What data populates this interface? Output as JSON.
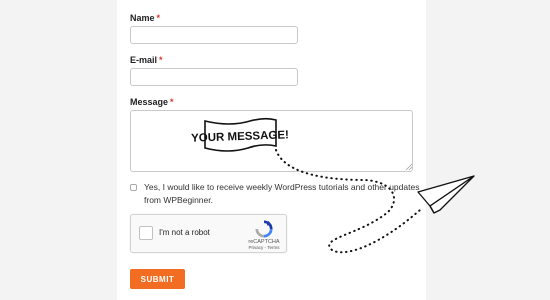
{
  "form": {
    "name_label": "Name",
    "email_label": "E-mail",
    "message_label": "Message",
    "required_mark": "*",
    "name_value": "",
    "email_value": "",
    "message_value": "",
    "consent_line1": "Yes, I would like to receive weekly WordPress tutorials and other updates",
    "consent_line2": "from WPBeginner.",
    "submit_label": "SUBMIT"
  },
  "captcha": {
    "label": "I'm not a robot",
    "brand": "reCAPTCHA",
    "links": "Privacy - Terms"
  },
  "annotation": {
    "sign_text": "YOUR MESSAGE!",
    "icon": "paper-plane-icon"
  },
  "colors": {
    "required": "#e0352b",
    "submit_bg": "#f26d21",
    "page_bg": "#f3f3f3"
  }
}
